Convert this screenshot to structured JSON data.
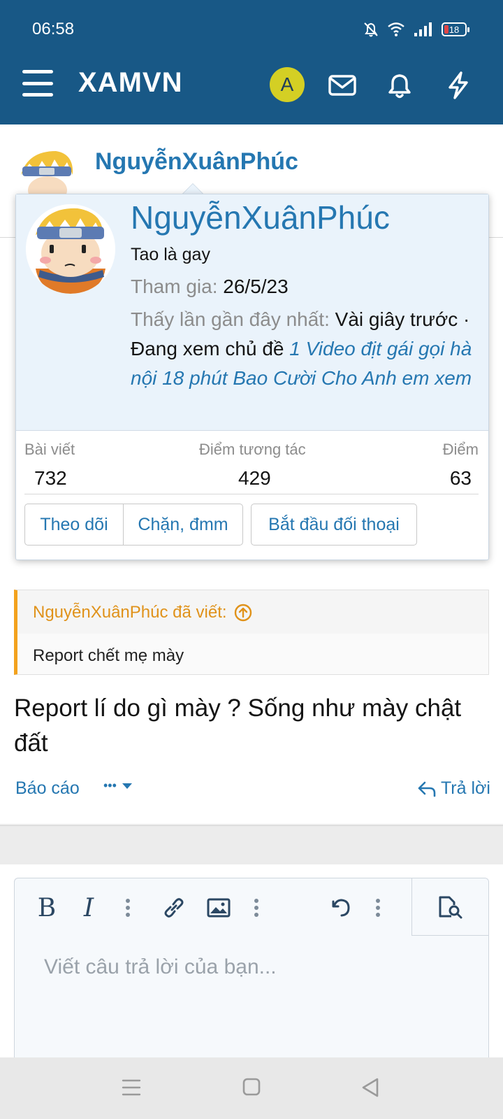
{
  "status_bar": {
    "time": "06:58",
    "battery": "18"
  },
  "header": {
    "logo": "XAMVN",
    "account_initial": "A"
  },
  "member": {
    "name": "NguyễnXuânPhúc"
  },
  "tooltip": {
    "name": "NguyễnXuânPhúc",
    "user_title": "Tao là gay",
    "joined_label": "Tham gia:",
    "joined_value": "26/5/23",
    "last_seen_label": "Thấy lần gần đây nhất:",
    "last_seen_value": "Vài giây trước",
    "activity_prefix": "· Đang xem chủ đề",
    "activity_thread": "1 Video địt gái gọi hà nội 18 phút Bao Cười Cho Anh em xem",
    "stats": [
      {
        "label": "Bài viết",
        "value": "732"
      },
      {
        "label": "Điểm tương tác",
        "value": "429"
      },
      {
        "label": "Điểm",
        "value": "63"
      }
    ],
    "buttons": {
      "follow": "Theo dõi",
      "block": "Chặn, đmm",
      "start_conversation": "Bắt đầu đối thoại"
    }
  },
  "post": {
    "quote_author": "NguyễnXuânPhúc đã viết:",
    "quote_text": "Report chết mẹ mày",
    "body": "Report lí do gì mày ? Sống như mày chật đất",
    "actions": {
      "report": "Báo cáo",
      "more": "•••",
      "reply": "Trả lời"
    }
  },
  "editor": {
    "placeholder": "Viết câu trả lời của bạn..."
  }
}
